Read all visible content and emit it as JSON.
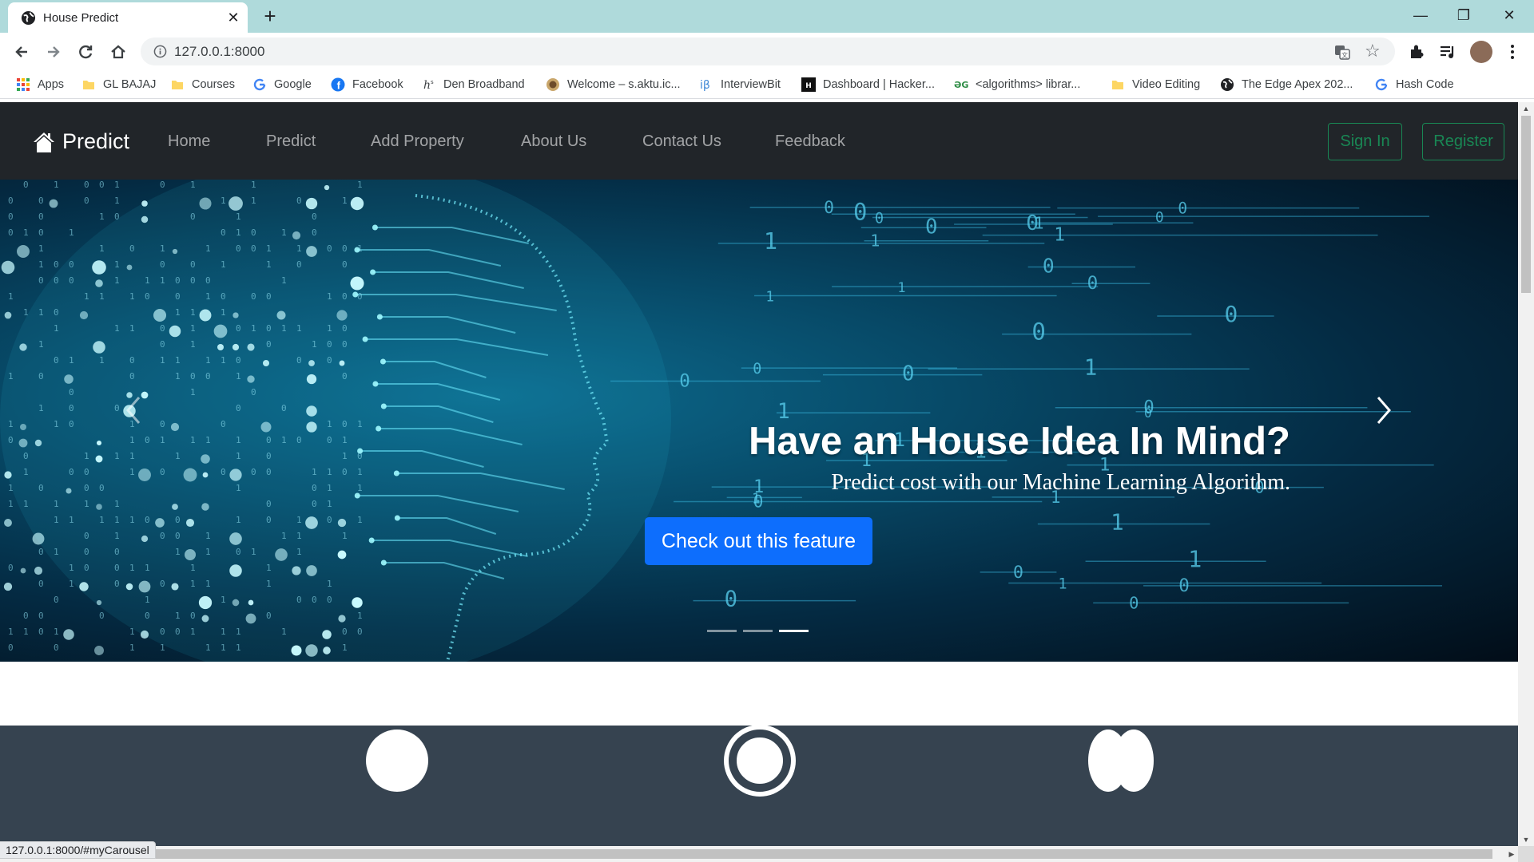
{
  "browser": {
    "tab_title": "House Predict",
    "url": "127.0.0.1:8000",
    "status_url": "127.0.0.1:8000/#myCarousel",
    "bookmarks": [
      {
        "label": "Apps",
        "icon": "apps-grid-icon"
      },
      {
        "label": "GL BAJAJ",
        "icon": "folder-icon"
      },
      {
        "label": "Courses",
        "icon": "folder-icon"
      },
      {
        "label": "Google",
        "icon": "google-icon"
      },
      {
        "label": "Facebook",
        "icon": "facebook-icon"
      },
      {
        "label": "Den Broadband",
        "icon": "hs-icon"
      },
      {
        "label": "Welcome – s.aktu.ic...",
        "icon": "aktu-icon"
      },
      {
        "label": "InterviewBit",
        "icon": "interviewbit-icon"
      },
      {
        "label": "Dashboard | Hacker...",
        "icon": "hackerrank-icon"
      },
      {
        "label": "<algorithms> librar...",
        "icon": "gfg-icon"
      },
      {
        "label": "Video Editing",
        "icon": "folder-icon"
      },
      {
        "label": "The Edge Apex 202...",
        "icon": "globe-icon"
      },
      {
        "label": "Hash Code",
        "icon": "google-icon"
      }
    ]
  },
  "navbar": {
    "brand": "Predict",
    "links": [
      "Home",
      "Predict",
      "Add Property",
      "About Us",
      "Contact Us",
      "Feedback"
    ],
    "signin": "Sign In",
    "register": "Register"
  },
  "hero": {
    "title": "Have an House Idea In Mind?",
    "subtitle": "Predict cost with our Machine Learning Algorithm.",
    "button": "Check out this feature",
    "active_slide": 3,
    "slide_count": 3
  },
  "colors": {
    "navbar_bg": "#212529",
    "success": "#198754",
    "primary": "#0d6efd",
    "dark_section": "#364350",
    "tabbar": "#afdadb"
  }
}
